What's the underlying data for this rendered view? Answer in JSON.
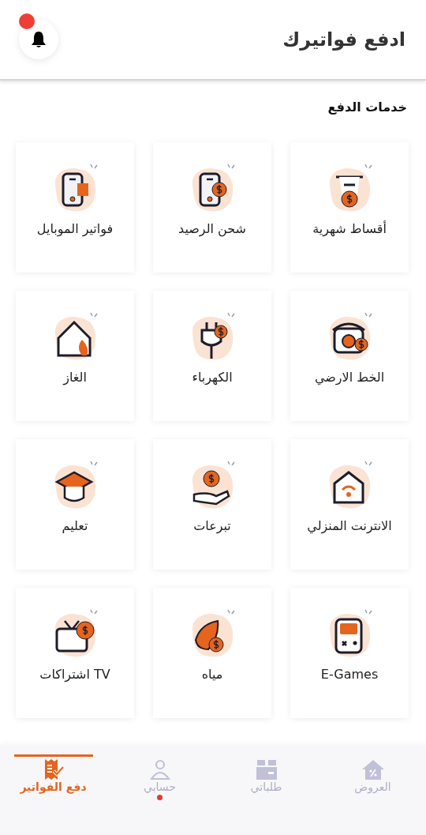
{
  "header": {
    "title": "ادفع فواتيرك",
    "bell": {
      "notification": true
    }
  },
  "section_title": "خدمات الدفع",
  "services": [
    {
      "label": "أقساط شهرية"
    },
    {
      "label": "شحن الرصيد"
    },
    {
      "label": "فواتير الموبايل"
    },
    {
      "label": "الخط الارضي"
    },
    {
      "label": "الكهرباء"
    },
    {
      "label": "الغاز"
    },
    {
      "label": "الانترنت المنزلي"
    },
    {
      "label": "تبرعات"
    },
    {
      "label": "تعليم"
    },
    {
      "label": "E-Games"
    },
    {
      "label": "مياه"
    },
    {
      "label": "TV اشتراكات"
    }
  ],
  "bottom_nav": [
    {
      "label": "العروض",
      "selected": false,
      "badge": false
    },
    {
      "label": "طلباتي",
      "selected": false,
      "badge": false
    },
    {
      "label": "حسابي",
      "selected": false,
      "badge": true
    },
    {
      "label": "دفع الفواتير",
      "selected": true,
      "badge": false
    }
  ]
}
